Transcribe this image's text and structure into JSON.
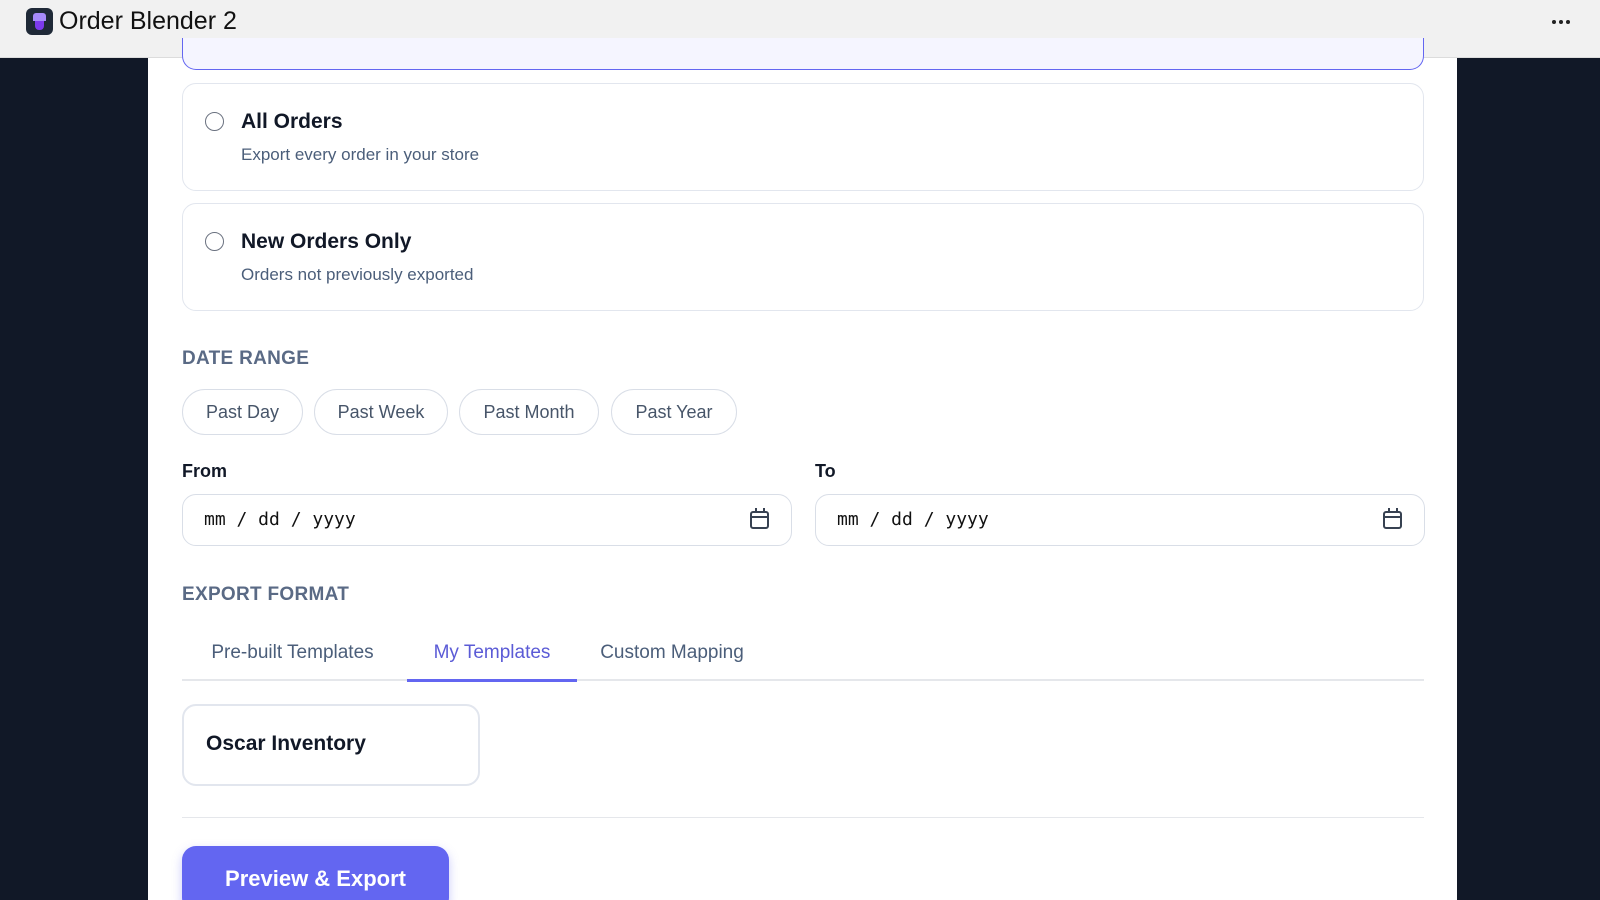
{
  "window": {
    "title": "Order Blender 2",
    "icon": "app-logo-icon",
    "menu_icon": "more-horizontal-icon"
  },
  "order_options": [
    {
      "title": "All Orders",
      "description": "Export every order in your store",
      "selected": false
    },
    {
      "title": "New Orders Only",
      "description": "Orders not previously exported",
      "selected": false
    }
  ],
  "date_range": {
    "label": "DATE RANGE",
    "presets": [
      "Past Day",
      "Past Week",
      "Past Month",
      "Past Year"
    ],
    "from_label": "From",
    "to_label": "To",
    "from_placeholder": "mm / dd / yyyy",
    "to_placeholder": "mm / dd / yyyy",
    "calendar_icon": "calendar-icon"
  },
  "export_format": {
    "label": "EXPORT FORMAT",
    "tabs": [
      "Pre-built Templates",
      "My Templates",
      "Custom Mapping"
    ],
    "active_tab": "My Templates",
    "templates": [
      "Oscar Inventory"
    ]
  },
  "actions": {
    "primary_label": "Preview & Export"
  },
  "colors": {
    "accent": "#6366f1",
    "page_background": "#111827",
    "panel": "#ffffff",
    "titlebar": "#f1f1f1"
  }
}
